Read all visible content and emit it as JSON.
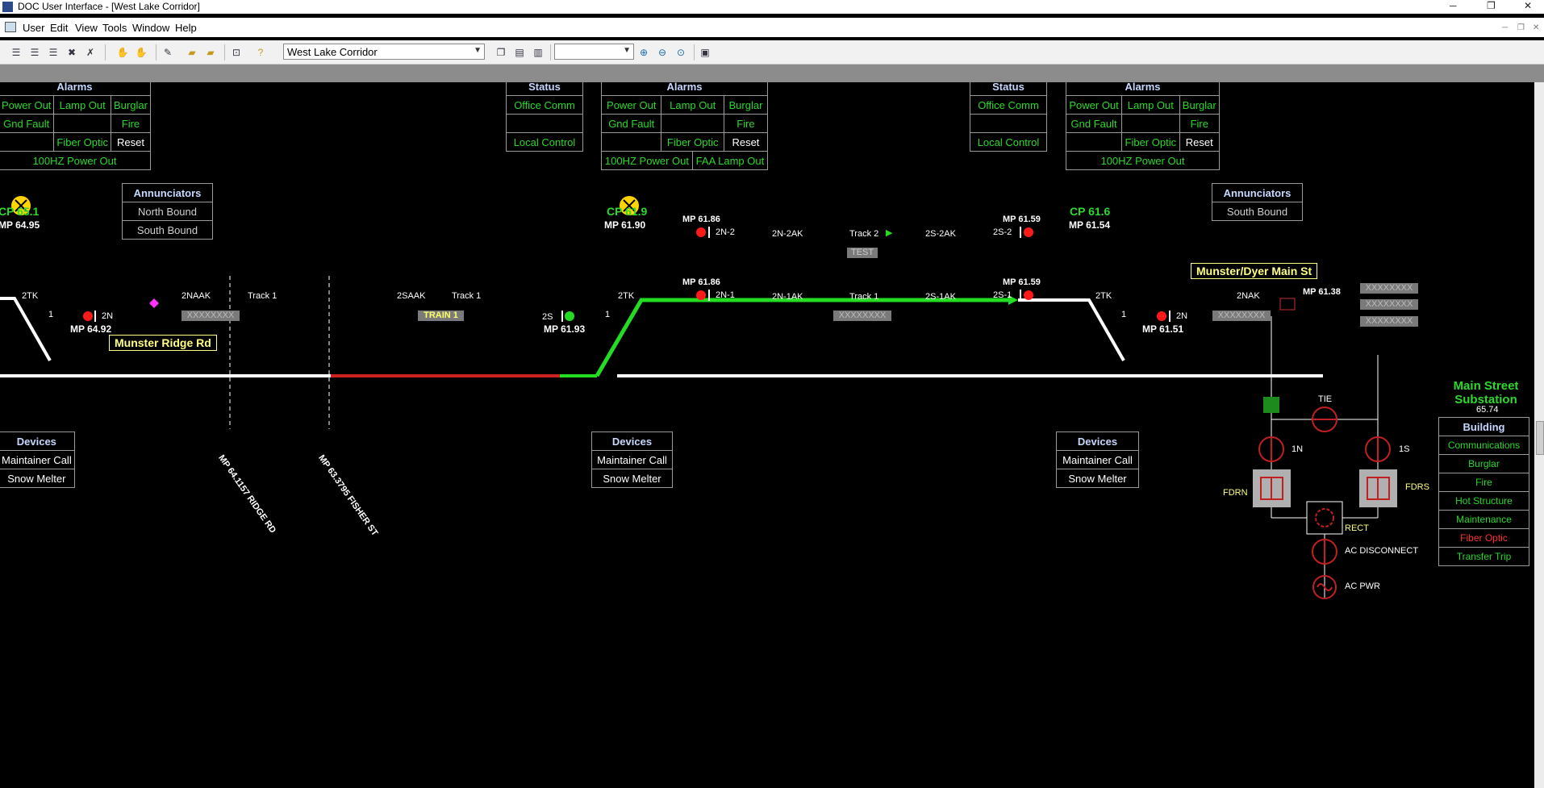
{
  "window": {
    "title": "DOC User Interface - [West Lake Corridor]"
  },
  "menu": [
    "User",
    "Edit",
    "View",
    "Tools",
    "Window",
    "Help"
  ],
  "toolbar": {
    "corridor_select": "West Lake Corridor",
    "zoom_select": ""
  },
  "alarm_panels": [
    {
      "title": "Alarms",
      "rows": [
        [
          "Power Out",
          "Lamp Out",
          "Burglar"
        ],
        [
          "Gnd Fault",
          "",
          "Fire"
        ],
        [
          "",
          "Fiber Optic",
          "Reset"
        ]
      ],
      "footer": "100HZ Power Out"
    },
    {
      "title": "Alarms",
      "rows": [
        [
          "Power Out",
          "Lamp Out",
          "Burglar"
        ],
        [
          "Gnd Fault",
          "",
          "Fire"
        ],
        [
          "",
          "Fiber Optic",
          "Reset"
        ]
      ],
      "footer_left": "100HZ Power Out",
      "footer_right": "FAA Lamp Out"
    },
    {
      "title": "Alarms",
      "rows": [
        [
          "Power Out",
          "Lamp Out",
          "Burglar"
        ],
        [
          "Gnd Fault",
          "",
          "Fire"
        ],
        [
          "",
          "Fiber Optic",
          "Reset"
        ]
      ],
      "footer": "100HZ Power Out"
    }
  ],
  "status_panels": [
    {
      "title": "Status",
      "rows": [
        "Office Comm",
        "",
        "Local Control"
      ]
    },
    {
      "title": "Status",
      "rows": [
        "Office Comm",
        "",
        "Local Control"
      ]
    }
  ],
  "control_points": [
    {
      "name": "CP 65.1",
      "mp": "MP 64.95"
    },
    {
      "name": "CP 61.9",
      "mp": "MP 61.90"
    },
    {
      "name": "CP 61.6",
      "mp": "MP 61.54"
    }
  ],
  "annunciators": [
    {
      "title": "Annunciators",
      "rows": [
        "North Bound",
        "South Bound"
      ]
    },
    {
      "title": "Annunciators",
      "rows": [
        "South Bound"
      ]
    }
  ],
  "device_panels": [
    {
      "title": "Devices",
      "rows": [
        "Maintainer Call",
        "Snow Melter"
      ]
    },
    {
      "title": "Devices",
      "rows": [
        "Maintainer Call",
        "Snow Melter"
      ]
    },
    {
      "title": "Devices",
      "rows": [
        "Maintainer Call",
        "Snow Melter"
      ]
    }
  ],
  "track_labels": {
    "2tk_a": "2TK",
    "one_a": "1",
    "sig_2n_a": "2N",
    "mp_6492": "MP 64.92",
    "l_2naak": "2NAAK",
    "track1_a": "Track 1",
    "l_2saak": "2SAAK",
    "track1_b": "Track 1",
    "train": "TRAIN 1",
    "sig_2s": "2S",
    "mp_6193": "MP 61.93",
    "2tk_b": "2TK",
    "one_b": "1",
    "mp_6186a": "MP 61.86",
    "sig_2n2": "2N-2",
    "l_2n2ak": "2N-2AK",
    "track2": "Track 2",
    "l_2s2ak": "2S-2AK",
    "sig_2s2": "2S-2",
    "mp_6159a": "MP 61.59",
    "test": "TEST",
    "mp_6186b": "MP 61.86",
    "sig_2n1": "2N-1",
    "l_2n1ak": "2N-1AK",
    "track1_c": "Track 1",
    "l_2s1ak": "2S-1AK",
    "sig_2s1": "2S-1",
    "mp_6159b": "MP 61.59",
    "2tk_c": "2TK",
    "one_c": "1",
    "sig_2n_b": "2N",
    "mp_6151": "MP 61.51",
    "l_2nak": "2NAK",
    "mp_6138": "MP 61.38",
    "block": "XXXXXXXX"
  },
  "crossings": [
    {
      "label": "Munster Ridge Rd"
    },
    {
      "label": "Munster/Dyer Main St"
    }
  ],
  "crossing_marks": [
    "MP 64.1157 RIDGE RD",
    "MP 63.3795 FISHER ST"
  ],
  "substation": {
    "title": "Main Street Substation",
    "mp": "65.74",
    "building": {
      "title": "Building",
      "rows": [
        "Communications",
        "Burglar",
        "Fire",
        "Hot Structure",
        "Maintenance",
        "Fiber Optic",
        "Transfer Trip"
      ]
    },
    "labels": {
      "tie": "TIE",
      "n1": "1N",
      "s1": "1S",
      "fdrn": "FDRN",
      "fdrs": "FDRS",
      "rect": "RECT",
      "acdisc": "AC DISCONNECT",
      "acpwr": "AC PWR"
    }
  },
  "colors": {
    "track_white": "#ffffff",
    "track_green": "#22dd22",
    "track_red": "#cc2222",
    "signal_red": "#ff1a1a",
    "signal_green": "#22dd22",
    "label_yellow": "#ffff80"
  }
}
